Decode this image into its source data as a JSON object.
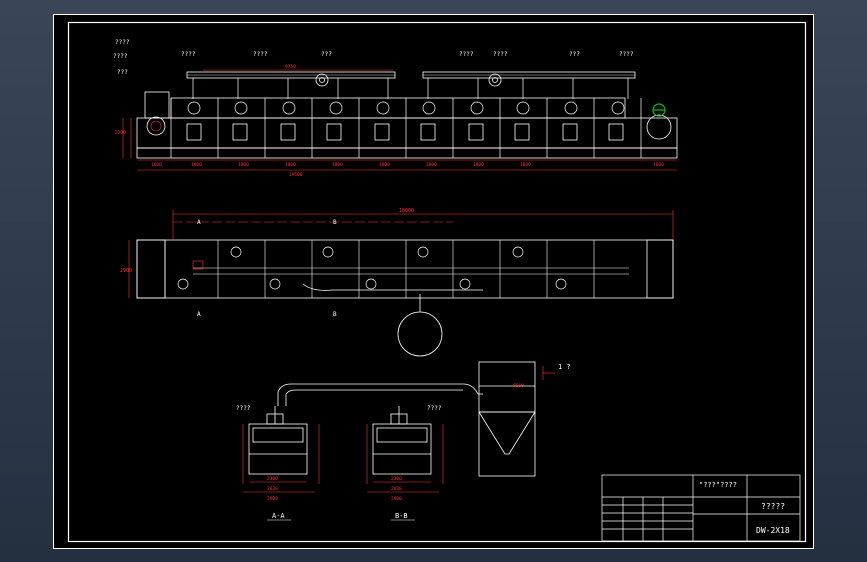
{
  "drawing": {
    "callouts_top": [
      "????",
      "????",
      "????",
      "???",
      "????",
      "????",
      "???",
      "????",
      "????",
      "???"
    ],
    "callouts_left": [
      "????",
      "???"
    ],
    "dim_total_top": "9750",
    "dim_segments": [
      "1600",
      "1800",
      "1800",
      "1800",
      "1800",
      "1800",
      "1800",
      "1800",
      "1800",
      "1600"
    ],
    "dim_overall": "19500",
    "dim_plan_total": "18000",
    "dim_height_left": "2290",
    "dim_plan_height": "2900",
    "section_a": "A",
    "section_b": "B",
    "callout_cyclone": "1 ?",
    "dim_cyclone": "Ø560",
    "callout_sec_a": "????",
    "callout_sec_b": "????",
    "sec_a_dims": [
      "2300",
      "2630",
      "2900"
    ],
    "sec_b_dims": [
      "2300",
      "2630",
      "2900"
    ],
    "sec_a_label": "A-A",
    "sec_b_label": "B-B"
  },
  "title_block": {
    "company": "\"???\"????",
    "drawing_name": "?????",
    "drawing_number": "DW-2X18"
  },
  "colors": {
    "line": "#ffffff",
    "dimension": "#ff3030",
    "accent": "#00c800",
    "paper": "#000000"
  }
}
